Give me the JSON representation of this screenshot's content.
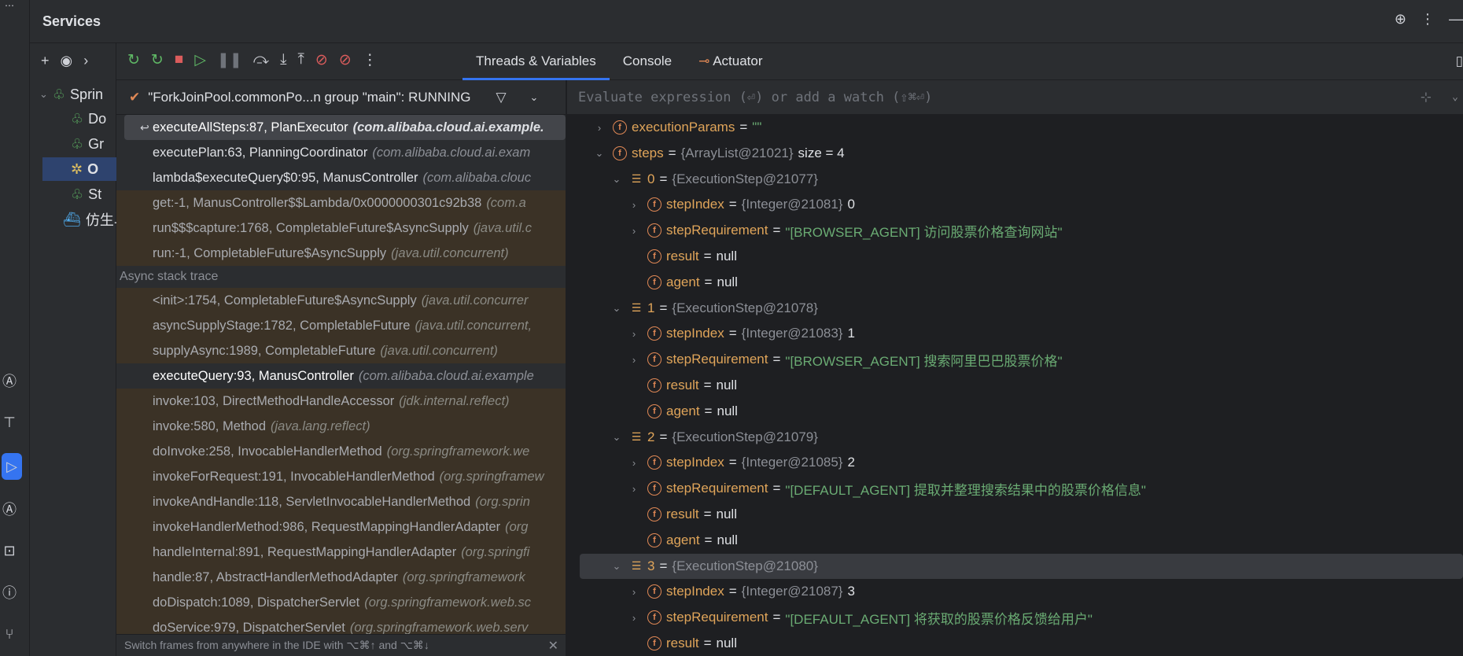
{
  "header": {
    "title": "Services"
  },
  "tree": {
    "nodes": [
      {
        "label": "Sprin",
        "icon": "spring-leaf-icon"
      },
      {
        "label": "Do",
        "icon": "spring-leaf-icon"
      },
      {
        "label": "Gr",
        "icon": "spring-leaf-icon"
      },
      {
        "label": "O",
        "icon": "debug-bug-icon"
      },
      {
        "label": "St",
        "icon": "spring-leaf-icon"
      },
      {
        "label": "仿生鸟",
        "icon": "docker-icon"
      }
    ]
  },
  "tabs": [
    {
      "label": "Threads & Variables",
      "active": true
    },
    {
      "label": "Console",
      "active": false
    },
    {
      "label": "Actuator",
      "active": false
    }
  ],
  "thread": {
    "label": "\"ForkJoinPool.commonPo...n group \"main\": RUNNING"
  },
  "frames_top": [
    {
      "method": "executeAllSteps:87, PlanExecutor",
      "cls": "(com.alibaba.cloud.ai.example.",
      "kind": "cur"
    },
    {
      "method": "executePlan:63, PlanningCoordinator",
      "cls": "(com.alibaba.cloud.ai.exam",
      "kind": "app"
    },
    {
      "method": "lambda$executeQuery$0:95, ManusController",
      "cls": "(com.alibaba.clouc",
      "kind": "app"
    },
    {
      "method": "get:-1, ManusController$$Lambda/0x0000000301c92b38",
      "cls": "(com.a",
      "kind": "lib"
    },
    {
      "method": "run$$$capture:1768, CompletableFuture$AsyncSupply",
      "cls": "(java.util.c",
      "kind": "lib"
    },
    {
      "method": "run:-1, CompletableFuture$AsyncSupply",
      "cls": "(java.util.concurrent)",
      "kind": "lib"
    }
  ],
  "async_label": "Async stack trace",
  "frames_async": [
    {
      "method": "<init>:1754, CompletableFuture$AsyncSupply",
      "cls": "(java.util.concurrer",
      "kind": "lib"
    },
    {
      "method": "asyncSupplyStage:1782, CompletableFuture",
      "cls": "(java.util.concurrent,",
      "kind": "lib"
    },
    {
      "method": "supplyAsync:1989, CompletableFuture",
      "cls": "(java.util.concurrent)",
      "kind": "lib"
    },
    {
      "method": "executeQuery:93, ManusController",
      "cls": "(com.alibaba.cloud.ai.example",
      "kind": "app2"
    },
    {
      "method": "invoke:103, DirectMethodHandleAccessor",
      "cls": "(jdk.internal.reflect)",
      "kind": "lib"
    },
    {
      "method": "invoke:580, Method",
      "cls": "(java.lang.reflect)",
      "kind": "lib"
    },
    {
      "method": "doInvoke:258, InvocableHandlerMethod",
      "cls": "(org.springframework.we",
      "kind": "lib"
    },
    {
      "method": "invokeForRequest:191, InvocableHandlerMethod",
      "cls": "(org.springframew",
      "kind": "lib"
    },
    {
      "method": "invokeAndHandle:118, ServletInvocableHandlerMethod",
      "cls": "(org.sprin",
      "kind": "lib"
    },
    {
      "method": "invokeHandlerMethod:986, RequestMappingHandlerAdapter",
      "cls": "(org",
      "kind": "lib"
    },
    {
      "method": "handleInternal:891, RequestMappingHandlerAdapter",
      "cls": "(org.springfi",
      "kind": "lib"
    },
    {
      "method": "handle:87, AbstractHandlerMethodAdapter",
      "cls": "(org.springframework",
      "kind": "lib"
    },
    {
      "method": "doDispatch:1089, DispatcherServlet",
      "cls": "(org.springframework.web.sc",
      "kind": "lib"
    },
    {
      "method": "doService:979, DispatcherServlet",
      "cls": "(org.springframework.web.serv",
      "kind": "lib"
    }
  ],
  "frames_footer": "Switch frames from anywhere in the IDE with ⌥⌘↑ and ⌥⌘↓",
  "eval_placeholder": "Evaluate expression (⏎) or add a watch (⇧⌘⏎)",
  "variables": [
    {
      "indent": 0,
      "chev": "›",
      "badge": "f",
      "name": "executionParams",
      "type": "",
      "str": "\"\"",
      "plain": ""
    },
    {
      "indent": 0,
      "chev": "⌄",
      "badge": "f",
      "name": "steps",
      "type": "{ArrayList@21021}",
      "str": "",
      "plain": "size = 4"
    },
    {
      "indent": 1,
      "chev": "⌄",
      "badge": "arr",
      "name": "0",
      "type": "{ExecutionStep@21077}",
      "str": "",
      "plain": ""
    },
    {
      "indent": 2,
      "chev": "›",
      "badge": "f",
      "name": "stepIndex",
      "type": "{Integer@21081}",
      "str": "",
      "plain": "0"
    },
    {
      "indent": 2,
      "chev": "›",
      "badge": "f",
      "name": "stepRequirement",
      "type": "",
      "str": "\"[BROWSER_AGENT] 访问股票价格查询网站\"",
      "plain": ""
    },
    {
      "indent": 2,
      "chev": "",
      "badge": "f",
      "name": "result",
      "type": "",
      "str": "",
      "plain": "null"
    },
    {
      "indent": 2,
      "chev": "",
      "badge": "f",
      "name": "agent",
      "type": "",
      "str": "",
      "plain": "null"
    },
    {
      "indent": 1,
      "chev": "⌄",
      "badge": "arr",
      "name": "1",
      "type": "{ExecutionStep@21078}",
      "str": "",
      "plain": ""
    },
    {
      "indent": 2,
      "chev": "›",
      "badge": "f",
      "name": "stepIndex",
      "type": "{Integer@21083}",
      "str": "",
      "plain": "1"
    },
    {
      "indent": 2,
      "chev": "›",
      "badge": "f",
      "name": "stepRequirement",
      "type": "",
      "str": "\"[BROWSER_AGENT] 搜索阿里巴巴股票价格\"",
      "plain": ""
    },
    {
      "indent": 2,
      "chev": "",
      "badge": "f",
      "name": "result",
      "type": "",
      "str": "",
      "plain": "null"
    },
    {
      "indent": 2,
      "chev": "",
      "badge": "f",
      "name": "agent",
      "type": "",
      "str": "",
      "plain": "null"
    },
    {
      "indent": 1,
      "chev": "⌄",
      "badge": "arr",
      "name": "2",
      "type": "{ExecutionStep@21079}",
      "str": "",
      "plain": ""
    },
    {
      "indent": 2,
      "chev": "›",
      "badge": "f",
      "name": "stepIndex",
      "type": "{Integer@21085}",
      "str": "",
      "plain": "2"
    },
    {
      "indent": 2,
      "chev": "›",
      "badge": "f",
      "name": "stepRequirement",
      "type": "",
      "str": "\"[DEFAULT_AGENT] 提取并整理搜索结果中的股票价格信息\"",
      "plain": ""
    },
    {
      "indent": 2,
      "chev": "",
      "badge": "f",
      "name": "result",
      "type": "",
      "str": "",
      "plain": "null"
    },
    {
      "indent": 2,
      "chev": "",
      "badge": "f",
      "name": "agent",
      "type": "",
      "str": "",
      "plain": "null"
    },
    {
      "indent": 1,
      "chev": "⌄",
      "badge": "arr",
      "name": "3",
      "type": "{ExecutionStep@21080}",
      "str": "",
      "plain": "",
      "selected": true
    },
    {
      "indent": 2,
      "chev": "›",
      "badge": "f",
      "name": "stepIndex",
      "type": "{Integer@21087}",
      "str": "",
      "plain": "3"
    },
    {
      "indent": 2,
      "chev": "›",
      "badge": "f",
      "name": "stepRequirement",
      "type": "",
      "str": "\"[DEFAULT_AGENT] 将获取的股票价格反馈给用户\"",
      "plain": ""
    },
    {
      "indent": 2,
      "chev": "",
      "badge": "f",
      "name": "result",
      "type": "",
      "str": "",
      "plain": "null"
    },
    {
      "indent": 2,
      "chev": "",
      "badge": "f",
      "name": "agent",
      "type": "",
      "str": "",
      "plain": "null"
    }
  ],
  "colors": {
    "accent": "#3574f0",
    "string": "#6aab73",
    "field": "#e0a55a",
    "lib_frame": "#3b3226"
  }
}
